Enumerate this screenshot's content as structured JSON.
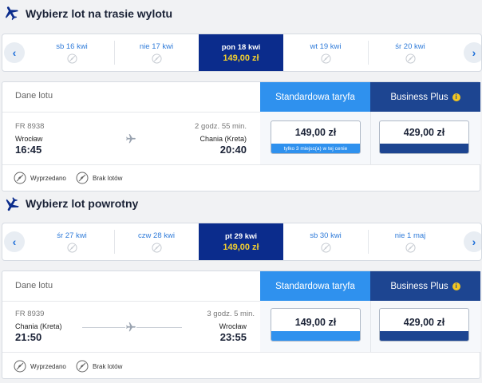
{
  "outbound": {
    "title": "Wybierz lot na trasie wylotu",
    "days": [
      {
        "label": "sb 16 kwi",
        "price": ""
      },
      {
        "label": "nie 17 kwi",
        "price": ""
      },
      {
        "label": "pon 18 kwi",
        "price": "149,00 zł"
      },
      {
        "label": "wt 19 kwi",
        "price": ""
      },
      {
        "label": "śr 20 kwi",
        "price": ""
      }
    ],
    "selected_index": 2,
    "header_label": "Dane lotu",
    "tab_standard": "Standardowa taryfa",
    "tab_business": "Business Plus",
    "flight": {
      "number": "FR 8938",
      "duration": "2 godz. 55 min.",
      "from_city": "Wrocław",
      "from_time": "16:45",
      "to_city": "Chania (Kreta)",
      "to_time": "20:40"
    },
    "fare_standard": {
      "price": "149,00 zł",
      "note": "tylko 3 miejsc(a) w tej cenie"
    },
    "fare_business": {
      "price": "429,00 zł",
      "note": ""
    },
    "legend": {
      "sold_out": "Wyprzedano",
      "no_flights": "Brak lotów"
    }
  },
  "return": {
    "title": "Wybierz lot powrotny",
    "days": [
      {
        "label": "śr 27 kwi",
        "price": ""
      },
      {
        "label": "czw 28 kwi",
        "price": ""
      },
      {
        "label": "pt 29 kwi",
        "price": "149,00 zł"
      },
      {
        "label": "sb 30 kwi",
        "price": ""
      },
      {
        "label": "nie 1 maj",
        "price": ""
      }
    ],
    "selected_index": 2,
    "header_label": "Dane lotu",
    "tab_standard": "Standardowa taryfa",
    "tab_business": "Business Plus",
    "flight": {
      "number": "FR 8939",
      "duration": "3 godz. 5 min.",
      "from_city": "Chania (Kreta)",
      "from_time": "21:50",
      "to_city": "Wrocław",
      "to_time": "23:55"
    },
    "fare_standard": {
      "price": "149,00 zł",
      "note": ""
    },
    "fare_business": {
      "price": "429,00 zł",
      "note": ""
    },
    "legend": {
      "sold_out": "Wyprzedano",
      "no_flights": "Brak lotów"
    }
  },
  "colors": {
    "selected_day": "#0b2c8c",
    "selected_price": "#f3d02f",
    "standard": "#2f91ee",
    "business": "#1d4591",
    "link": "#2f7bd9"
  },
  "icons": {
    "section": "plane-icon",
    "day": "no-flight-icon",
    "arrow_left": "chevron-left-icon",
    "arrow_right": "chevron-right-icon",
    "info": "info-icon"
  }
}
